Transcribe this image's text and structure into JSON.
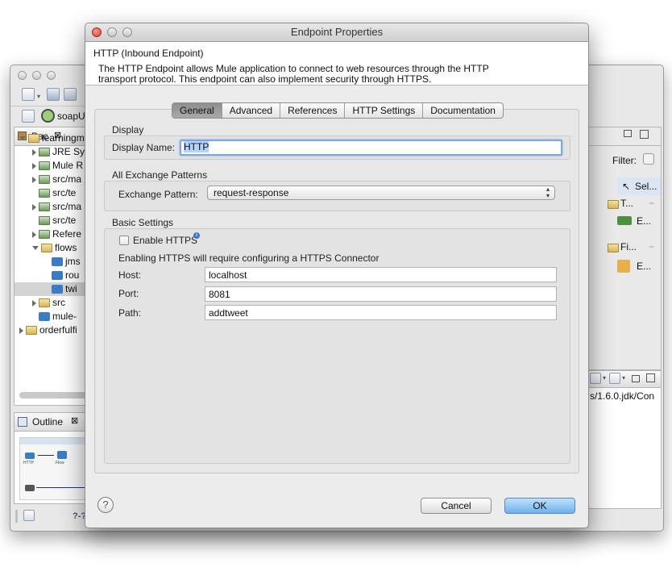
{
  "background_window": {
    "toolbar": {
      "perspective_label": "soapUI"
    },
    "package_explorer": {
      "tab_label": "Pac",
      "tree": [
        {
          "label": "learningm",
          "depth": 0,
          "expanded": true,
          "icon": "project-icon"
        },
        {
          "label": "JRE Sys",
          "depth": 1,
          "expanded": false,
          "icon": "library-icon"
        },
        {
          "label": "Mule R",
          "depth": 1,
          "expanded": false,
          "icon": "library-icon"
        },
        {
          "label": "src/ma",
          "depth": 1,
          "expanded": false,
          "icon": "source-folder-icon"
        },
        {
          "label": "src/te",
          "depth": 1,
          "expanded": null,
          "icon": "source-folder-icon"
        },
        {
          "label": "src/ma",
          "depth": 1,
          "expanded": false,
          "icon": "source-folder-icon"
        },
        {
          "label": "src/te",
          "depth": 1,
          "expanded": null,
          "icon": "source-folder-icon"
        },
        {
          "label": "Refere",
          "depth": 1,
          "expanded": false,
          "icon": "library-icon"
        },
        {
          "label": "flows",
          "depth": 1,
          "expanded": true,
          "icon": "folder-icon"
        },
        {
          "label": "jms",
          "depth": 2,
          "expanded": null,
          "icon": "mule-flow-icon"
        },
        {
          "label": "rou",
          "depth": 2,
          "expanded": null,
          "icon": "mule-flow-icon"
        },
        {
          "label": "twi",
          "depth": 2,
          "expanded": null,
          "icon": "mule-flow-icon",
          "selected": true
        },
        {
          "label": "src",
          "depth": 1,
          "expanded": false,
          "icon": "folder-icon"
        },
        {
          "label": "mule-",
          "depth": 1,
          "expanded": null,
          "icon": "mule-config-icon"
        },
        {
          "label": "orderfulfi",
          "depth": 0,
          "expanded": false,
          "icon": "project-icon"
        }
      ]
    },
    "outline": {
      "tab_label": "Outline",
      "labels": [
        "HTTP",
        "Flow"
      ]
    },
    "palette": {
      "filter_label": "Filter:",
      "select_label": "Sel...",
      "sections": [
        {
          "label": "T...",
          "item": "E..."
        },
        {
          "label": "Fi...",
          "item": "E..."
        }
      ]
    },
    "console": {
      "text": "s/1.6.0.jdk/Con"
    },
    "status_bar": {
      "help_label": "?-?"
    }
  },
  "dialog": {
    "title": "Endpoint Properties",
    "header_title": "HTTP (Inbound Endpoint)",
    "header_description": "The HTTP Endpoint allows Mule application to connect to web resources through the HTTP transport protocol. This endpoint can also implement security through HTTPS.",
    "tabs": [
      {
        "label": "General",
        "active": true
      },
      {
        "label": "Advanced",
        "active": false
      },
      {
        "label": "References",
        "active": false
      },
      {
        "label": "HTTP Settings",
        "active": false
      },
      {
        "label": "Documentation",
        "active": false
      }
    ],
    "display_section": {
      "title": "Display",
      "display_name_label": "Display Name:",
      "display_name_value": "HTTP"
    },
    "exchange_section": {
      "title": "All Exchange Patterns",
      "exchange_pattern_label": "Exchange Pattern:",
      "exchange_pattern_value": "request-response"
    },
    "basic_settings": {
      "title": "Basic Settings",
      "enable_https_label": "Enable HTTPS",
      "enable_https_checked": false,
      "https_note": "Enabling HTTPS will require configuring a HTTPS Connector",
      "host_label": "Host:",
      "host_value": "localhost",
      "port_label": "Port:",
      "port_value": "8081",
      "path_label": "Path:",
      "path_value": "addtweet"
    },
    "buttons": {
      "cancel": "Cancel",
      "ok": "OK"
    },
    "colors": {
      "focus_ring": "#7aa7e6",
      "ok_button": "#6fb0ee"
    }
  }
}
